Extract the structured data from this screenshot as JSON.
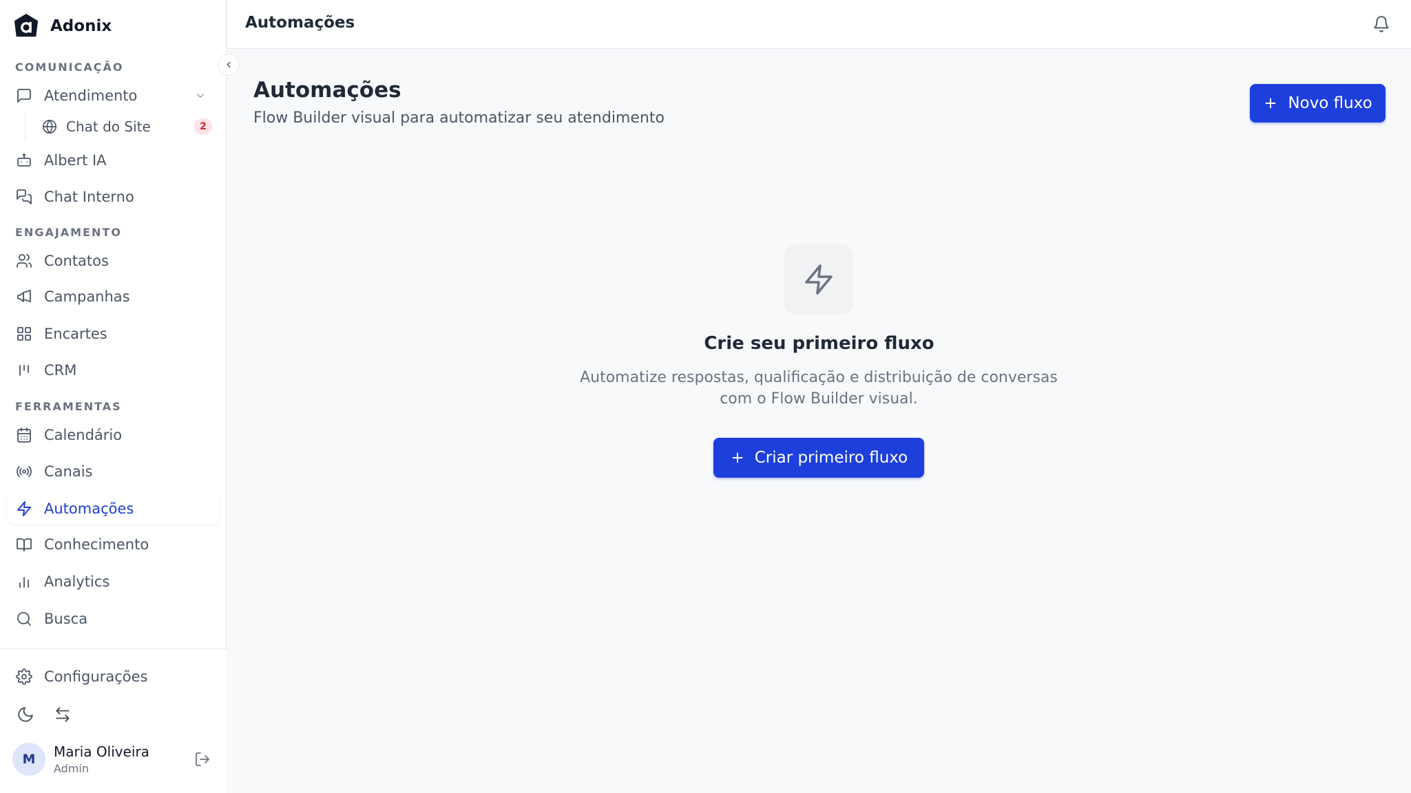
{
  "brand": {
    "name": "Adonix"
  },
  "sidebar": {
    "sections": {
      "comunicacao": "COMUNICAÇÃO",
      "engajamento": "ENGAJAMENTO",
      "ferramentas": "FERRAMENTAS"
    },
    "items": {
      "atendimento": "Atendimento",
      "chat_site": "Chat do Site",
      "chat_site_badge": "2",
      "albert": "Albert IA",
      "chat_interno": "Chat Interno",
      "contatos": "Contatos",
      "campanhas": "Campanhas",
      "encartes": "Encartes",
      "crm": "CRM",
      "calendario": "Calendário",
      "canais": "Canais",
      "automacoes": "Automações",
      "conhecimento": "Conhecimento",
      "analytics": "Analytics",
      "busca": "Busca"
    },
    "footer": {
      "configuracoes": "Configurações"
    },
    "user": {
      "initial": "M",
      "name": "Maria Oliveira",
      "role": "Admin"
    }
  },
  "topbar": {
    "title": "Automações"
  },
  "main": {
    "title": "Automações",
    "subtitle": "Flow Builder visual para automatizar seu atendimento",
    "new_flow_label": "Novo fluxo",
    "empty": {
      "title": "Crie seu primeiro fluxo",
      "description": "Automatize respostas, qualificação e distribuição de conversas com o Flow Builder visual.",
      "cta_label": "Criar primeiro fluxo"
    }
  },
  "colors": {
    "accent": "#1d3fdb",
    "active_text": "#1d3fcf",
    "badge_bg": "#fde2e7",
    "badge_text": "#dc2626"
  },
  "icons": {
    "brand": "adonix-logo-icon",
    "atendimento": "message-square-icon",
    "chat_site": "globe-icon",
    "albert": "bot-icon",
    "chat_interno": "messages-icon",
    "contatos": "users-icon",
    "campanhas": "megaphone-icon",
    "encartes": "grid-icon",
    "crm": "kanban-icon",
    "calendario": "calendar-icon",
    "canais": "radio-icon",
    "automacoes": "zap-icon",
    "conhecimento": "book-open-icon",
    "analytics": "bar-chart-icon",
    "busca": "search-icon",
    "configuracoes": "settings-icon",
    "theme": "moon-icon",
    "switch": "arrow-left-right-icon",
    "logout": "log-out-icon",
    "bell": "bell-icon",
    "plus": "plus-icon",
    "collapse": "chevron-left-icon"
  }
}
